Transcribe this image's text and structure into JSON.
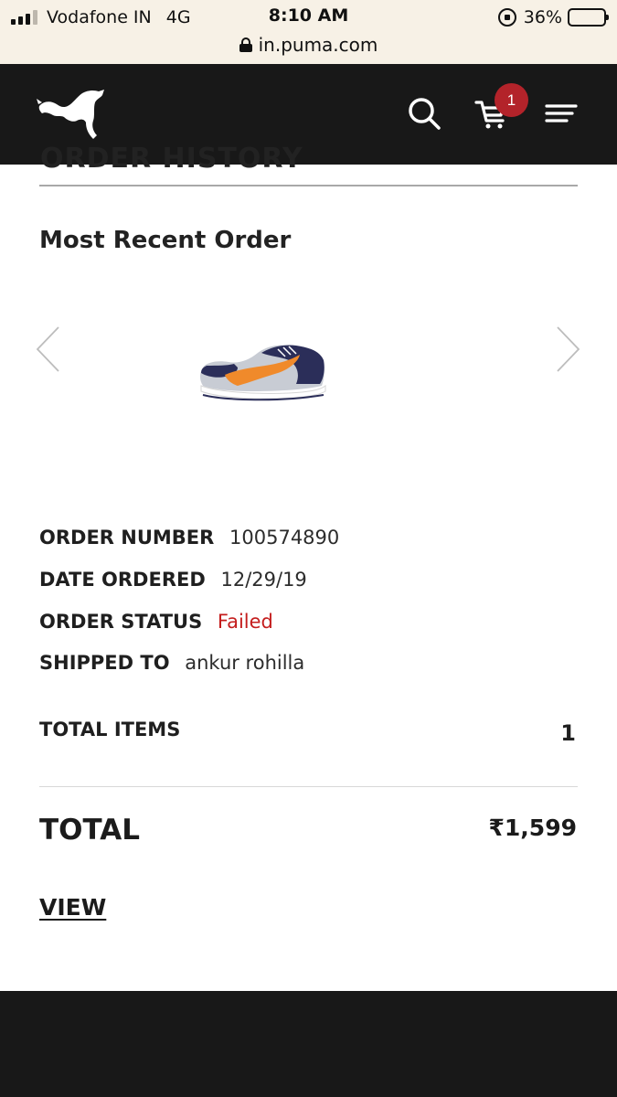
{
  "status_bar": {
    "carrier": "Vodafone IN",
    "network": "4G",
    "time": "8:10 AM",
    "battery": "36%",
    "battery_level": 0.36,
    "url": "in.puma.com"
  },
  "header": {
    "cart_count": "1",
    "icons": [
      "puma-logo",
      "search-icon",
      "cart-icon",
      "menu-icon"
    ]
  },
  "order_history": {
    "heading": "ORDER HISTORY"
  },
  "recent_order": {
    "title": "Most Recent Order",
    "fields": [
      {
        "label": "ORDER NUMBER",
        "value": "100574890"
      },
      {
        "label": "DATE ORDERED",
        "value": "12/29/19"
      },
      {
        "label": "ORDER STATUS",
        "value": "Failed"
      },
      {
        "label": "SHIPPED TO",
        "value": "ankur rohilla"
      }
    ],
    "total_items_label": "TOTAL ITEMS",
    "total_items_value": "1",
    "total_label": "TOTAL",
    "total_value": "₹1,599",
    "view_label": "VIEW"
  },
  "colors": {
    "header_bg": "#181818",
    "status_failed": "#c41d1d",
    "badge": "#b3232a"
  }
}
